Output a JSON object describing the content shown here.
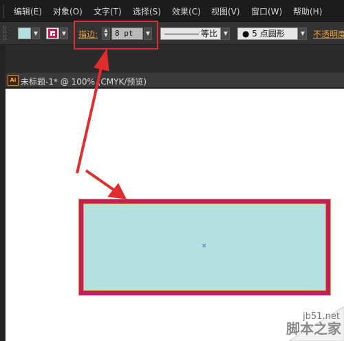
{
  "menu": {
    "items": [
      "编辑(E)",
      "对象(O)",
      "文字(T)",
      "选择(S)",
      "效果(C)",
      "视图(V)",
      "窗口(W)",
      "帮助(H)"
    ]
  },
  "control_bar": {
    "fill_color": "#b2e0e0",
    "stroke_color": "#c0205a",
    "stroke_label": "描边:",
    "stroke_weight": "8 pt",
    "profile_label": "等比",
    "brush_label": "● 5 点圆形",
    "opacity_label": "不透明度"
  },
  "document": {
    "tab_title": "未标题-1* @ 100% (CMYK/预览)",
    "app_icon_text": "Ai"
  },
  "canvas": {
    "rect_fill": "#b5e0e0",
    "rect_stroke": "#c0205a",
    "selection_color": "#e6963a",
    "center_mark": "×"
  },
  "annotation": {
    "highlight_color": "#e02d2d"
  },
  "watermark": {
    "site": "jb51.net",
    "name": "脚本之家"
  }
}
